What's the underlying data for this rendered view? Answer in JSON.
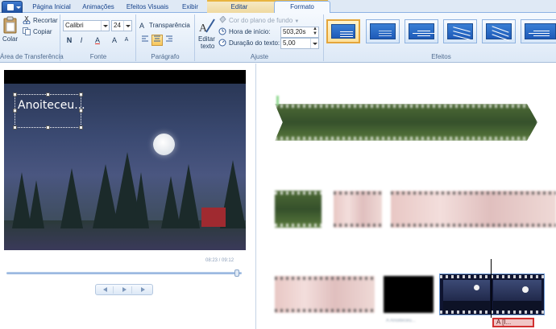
{
  "tabs": {
    "home": "Página Inicial",
    "animations": "Animações",
    "visual_effects": "Efeitos Visuais",
    "view": "Exibir",
    "edit": "Editar",
    "format": "Formato"
  },
  "clipboard": {
    "paste": "Colar",
    "cut": "Recortar",
    "copy": "Copiar",
    "group_label": "Área de Transferência"
  },
  "font": {
    "family": "Calibri",
    "size": "24",
    "bold": "N",
    "italic": "I",
    "color": "A",
    "grow": "A",
    "shrink": "A",
    "group_label": "Fonte"
  },
  "paragraph": {
    "transparency": "Transparência",
    "group_label": "Parágrafo"
  },
  "adjust": {
    "edit_text_line1": "Editar",
    "edit_text_line2": "texto",
    "background_color": "Cor do plano de fundo",
    "start_time_label": "Hora de início:",
    "start_time_value": "503,20s",
    "text_duration_label": "Duração do texto:",
    "text_duration_value": "5,00",
    "group_label": "Ajuste"
  },
  "effects": {
    "group_label": "Efeitos",
    "selected_index": 0
  },
  "preview": {
    "caption_text": "Anoiteceu...",
    "timecode": "08:23 / 09:12"
  },
  "storyboard": {
    "caption_tag": "A  [I...",
    "clip_label": "A  Anoiteceu..."
  },
  "colors": {
    "ribbon_bg": "#dce8f6",
    "accent_selected": "#e4a53a",
    "caption_tag_border": "#d23030"
  }
}
